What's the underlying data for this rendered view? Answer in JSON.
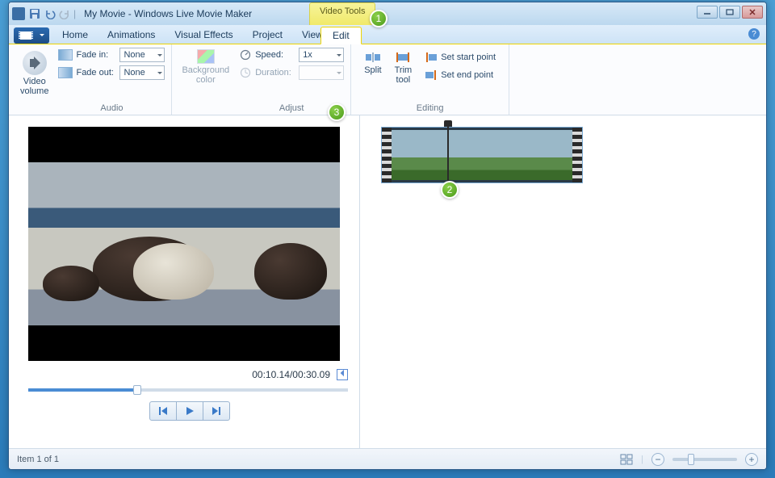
{
  "title": "My Movie - Windows Live Movie Maker",
  "contextual_tab": "Video Tools",
  "tabs": {
    "home": "Home",
    "animations": "Animations",
    "visual_effects": "Visual Effects",
    "project": "Project",
    "view": "View",
    "edit": "Edit"
  },
  "ribbon": {
    "video_volume": "Video\nvolume",
    "fade_in_label": "Fade in:",
    "fade_in_value": "None",
    "fade_out_label": "Fade out:",
    "fade_out_value": "None",
    "audio_group": "Audio",
    "bg_color": "Background\ncolor",
    "speed_label": "Speed:",
    "speed_value": "1x",
    "duration_label": "Duration:",
    "duration_value": "",
    "adjust_group": "Adjust",
    "split": "Split",
    "trim": "Trim\ntool",
    "set_start": "Set start point",
    "set_end": "Set end point",
    "editing_group": "Editing"
  },
  "preview": {
    "time": "00:10.14/00:30.09"
  },
  "status": {
    "item": "Item 1 of 1"
  },
  "badges": {
    "b1": "1",
    "b2": "2",
    "b3": "3"
  }
}
